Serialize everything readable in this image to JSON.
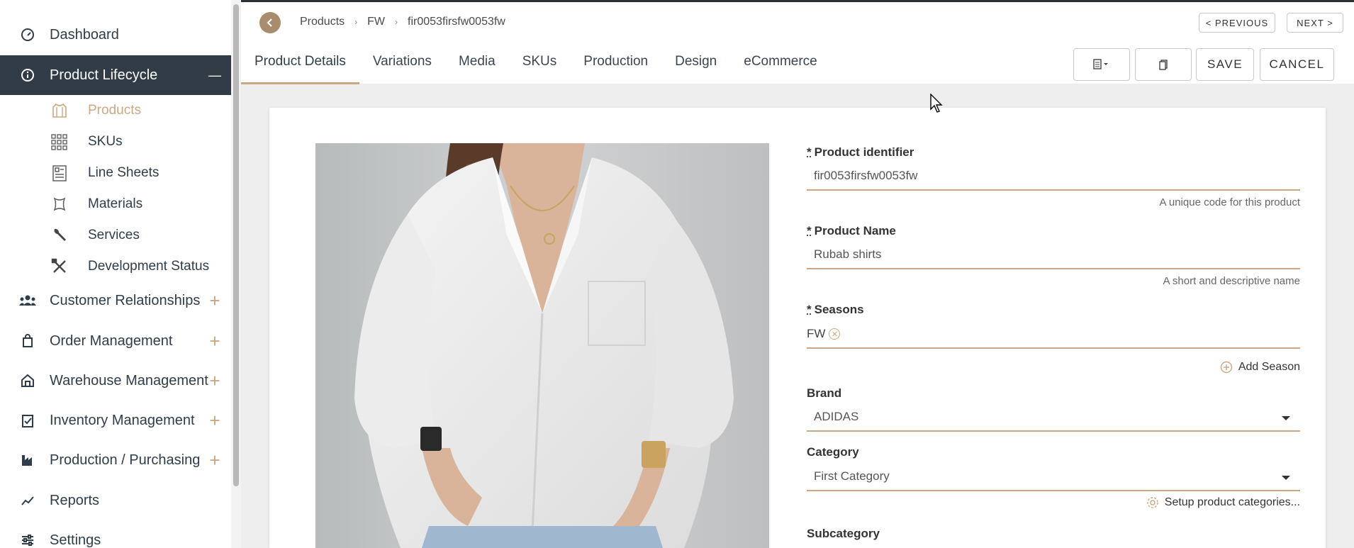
{
  "sidebar": {
    "items": [
      {
        "label": "Dashboard",
        "icon": "gauge-icon"
      },
      {
        "label": "Product Lifecycle",
        "icon": "info-circle-icon",
        "toggle": "—"
      },
      {
        "label": "Customer Relationships",
        "icon": "people-icon",
        "toggle": "+"
      },
      {
        "label": "Order Management",
        "icon": "shopping-bag-icon",
        "toggle": "+"
      },
      {
        "label": "Warehouse Management",
        "icon": "warehouse-icon",
        "toggle": "+"
      },
      {
        "label": "Inventory Management",
        "icon": "clipboard-check-icon",
        "toggle": "+"
      },
      {
        "label": "Production / Purchasing",
        "icon": "factory-icon",
        "toggle": "+"
      },
      {
        "label": "Reports",
        "icon": "line-chart-icon"
      },
      {
        "label": "Settings",
        "icon": "sliders-icon"
      }
    ],
    "subitems": [
      {
        "label": "Products",
        "icon": "shirt-icon"
      },
      {
        "label": "SKUs",
        "icon": "grid-icon"
      },
      {
        "label": "Line Sheets",
        "icon": "sheet-icon"
      },
      {
        "label": "Materials",
        "icon": "fabric-icon"
      },
      {
        "label": "Services",
        "icon": "wrench-icon"
      },
      {
        "label": "Development Status",
        "icon": "tools-icon"
      }
    ]
  },
  "breadcrumb": [
    "Products",
    "FW",
    "fir0053firsfw0053fw"
  ],
  "pager": {
    "previous": "< PREVIOUS",
    "next": "NEXT >"
  },
  "tabs": [
    "Product Details",
    "Variations",
    "Media",
    "SKUs",
    "Production",
    "Design",
    "eCommerce"
  ],
  "actions": {
    "save": "SAVE",
    "cancel": "CANCEL"
  },
  "form": {
    "product_identifier": {
      "required": "*",
      "label": "Product identifier",
      "value": "fir0053firsfw0053fw",
      "help": "A unique code for this product"
    },
    "product_name": {
      "required": "*",
      "label": "Product Name",
      "value": "Rubab shirts",
      "help": "A short and descriptive name"
    },
    "seasons": {
      "required": "*",
      "label": "Seasons",
      "chips": [
        "FW"
      ],
      "add_label": "Add Season"
    },
    "brand": {
      "label": "Brand",
      "value": "ADIDAS"
    },
    "category": {
      "label": "Category",
      "value": "First Category",
      "setup_label": "Setup product categories..."
    },
    "subcategory": {
      "label": "Subcategory"
    }
  },
  "colors": {
    "accent": "#c9a882",
    "sidebar_active": "#323c46",
    "text": "#2f3d4a"
  }
}
